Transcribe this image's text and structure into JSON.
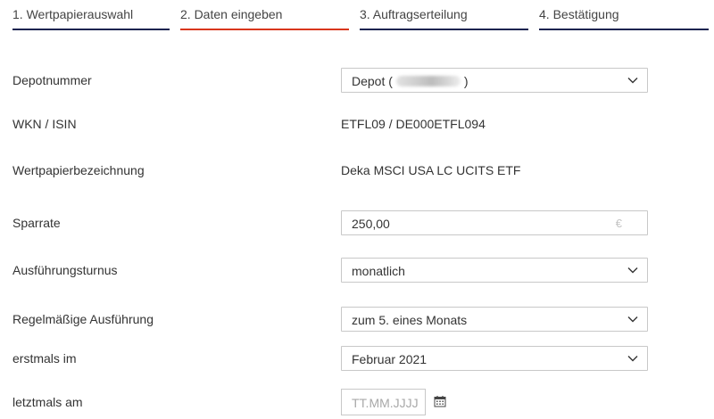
{
  "steps": [
    {
      "label": "1. Wertpapierauswahl",
      "active": false
    },
    {
      "label": "2. Daten eingeben",
      "active": true
    },
    {
      "label": "3. Auftragserteilung",
      "active": false
    },
    {
      "label": "4. Bestätigung",
      "active": false
    }
  ],
  "colors": {
    "step_line": "#1a2350",
    "step_line_active": "#d9361c",
    "field_border": "#c8c8c8",
    "text": "#333333",
    "placeholder": "#a8a8a8"
  },
  "form": {
    "depot": {
      "label": "Depotnummer",
      "prefix": "Depot (",
      "suffix": ")"
    },
    "wkn": {
      "label": "WKN / ISIN",
      "value": "ETFL09 / DE000ETFL094"
    },
    "name": {
      "label": "Wertpapierbezeichnung",
      "value": "Deka MSCI USA LC UCITS ETF"
    },
    "sparrate": {
      "label": "Sparrate",
      "value": "250,00",
      "currency": "€"
    },
    "turnus": {
      "label": "Ausführungsturnus",
      "value": "monatlich"
    },
    "regelmaessig": {
      "label": "Regelmäßige Ausführung",
      "value": "zum 5. eines Monats"
    },
    "erstmals": {
      "label": "erstmals im",
      "value": "Februar 2021"
    },
    "letztmals": {
      "label": "letztmals am",
      "placeholder": "TT.MM.JJJJ",
      "icon": "calendar-icon"
    }
  }
}
